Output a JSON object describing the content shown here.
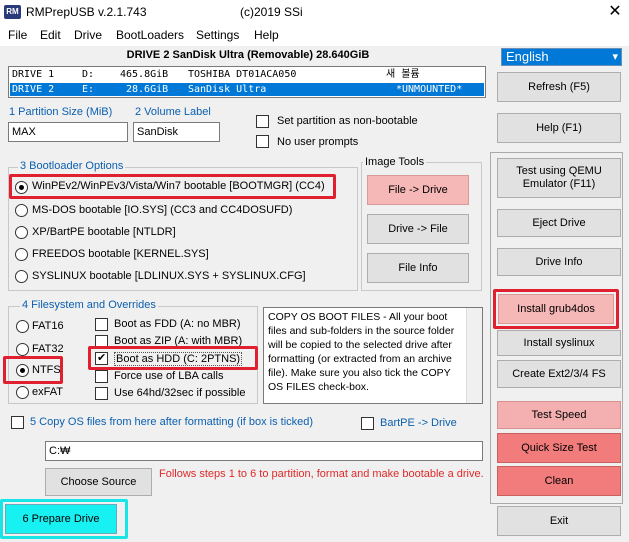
{
  "window": {
    "app_icon_text": "RM",
    "title": "RMPrepUSB v.2.1.743",
    "copyright": "(c)2019 SSi",
    "close_glyph": "✕"
  },
  "menu": [
    "File",
    "Edit",
    "Drive",
    "BootLoaders",
    "Settings",
    "Help"
  ],
  "drive_header": "DRIVE 2 SanDisk Ultra  (Removable) 28.640GiB",
  "drives": [
    {
      "name": "DRIVE 1",
      "letter": "D:",
      "size": "465.8GiB",
      "model": "TOSHIBA DT01ACA050",
      "label": "새 볼륨",
      "status": ""
    },
    {
      "name": "DRIVE 2",
      "letter": "E:",
      "size": "28.6GiB",
      "model": "SanDisk Ultra",
      "label": "",
      "status": "*UNMOUNTED*"
    }
  ],
  "language_select": {
    "value": "English",
    "arrow": "▾"
  },
  "partition": {
    "size_label": "1 Partition Size (MiB)",
    "size_value": "MAX",
    "volume_label": "2 Volume Label",
    "volume_value": "SanDisk"
  },
  "options": {
    "non_bootable": "Set partition as non-bootable",
    "no_prompts": "No user prompts"
  },
  "bootloader": {
    "title": "3 Bootloader Options",
    "items": [
      {
        "label": "WinPEv2/WinPEv3/Vista/Win7 bootable [BOOTMGR] (CC4)",
        "checked": true
      },
      {
        "label": "MS-DOS bootable [IO.SYS]     (CC3 and CC4DOSUFD)",
        "checked": false
      },
      {
        "label": "XP/BartPE bootable [NTLDR]",
        "checked": false
      },
      {
        "label": "FREEDOS bootable [KERNEL.SYS]",
        "checked": false
      },
      {
        "label": "SYSLINUX bootable [LDLINUX.SYS + SYSLINUX.CFG]",
        "checked": false
      }
    ]
  },
  "image_tools": {
    "title": "Image Tools",
    "file_to_drive": "File -> Drive",
    "drive_to_file": "Drive -> File",
    "file_info": "File Info"
  },
  "filesystem": {
    "title": "4 Filesystem and Overrides",
    "fs": [
      "FAT16",
      "FAT32",
      "NTFS",
      "exFAT"
    ],
    "selected": "NTFS",
    "overrides": [
      {
        "label": "Boot as FDD (A: no MBR)",
        "checked": false
      },
      {
        "label": "Boot as ZIP (A: with MBR)",
        "checked": false
      },
      {
        "label": "Boot as HDD (C: 2PTNS)",
        "checked": true
      },
      {
        "label": "Force use of LBA calls",
        "checked": false
      },
      {
        "label": "Use 64hd/32sec if possible",
        "checked": false
      }
    ]
  },
  "info_text": "COPY OS BOOT FILES - All your boot files and sub-folders in the source folder will be copied to the selected drive after formatting (or extracted from an archive file). Make sure you also tick the COPY OS FILES check-box.",
  "copy_os": {
    "label": "5 Copy OS files from here after formatting (if box is ticked)",
    "bartpe": "BartPE -> Drive",
    "path": "C:₩"
  },
  "choose_source": "Choose Source",
  "steps_note": "Follows steps 1 to 6 to partition, format and make bootable a drive.",
  "prepare_drive": "6 Prepare Drive",
  "right_buttons": {
    "refresh": "Refresh (F5)",
    "help": "Help (F1)",
    "qemu": "Test using QEMU Emulator (F11)",
    "eject": "Eject Drive",
    "drive_info": "Drive Info",
    "grub4dos": "Install grub4dos",
    "syslinux": "Install syslinux",
    "ext": "Create Ext2/3/4 FS",
    "test_speed": "Test Speed",
    "quick_size": "Quick Size Test",
    "clean": "Clean",
    "exit": "Exit"
  },
  "colors": {
    "highlight_red": "#e0202e",
    "selection_blue": "#0078d7",
    "label_blue": "#0b5fb0",
    "prepare_cyan": "#17f1f1"
  }
}
